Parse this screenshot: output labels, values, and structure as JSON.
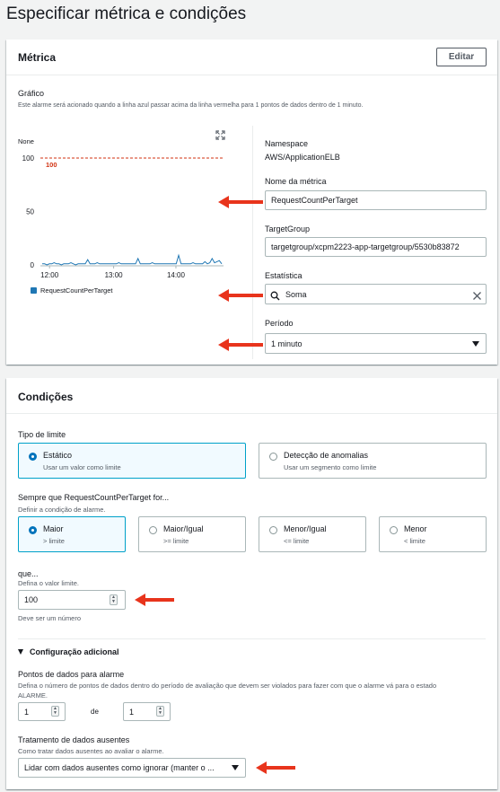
{
  "page": {
    "title": "Especificar métrica e condições"
  },
  "metric": {
    "section_title": "Métrica",
    "edit_label": "Editar",
    "graph_label": "Gráfico",
    "graph_desc": "Este alarme será acionado quando a linha azul passar acima da linha vermelha para 1 pontos de dados dentro de 1 minuto.",
    "expand_icon": "expand-icon",
    "chart_data": {
      "type": "line",
      "y_unit_label": "None",
      "ylim": [
        0,
        100
      ],
      "y_ticks": [
        "100",
        "50",
        "0"
      ],
      "x_ticks": [
        "12:00",
        "13:00",
        "14:00"
      ],
      "threshold": {
        "value": 100,
        "label": "100",
        "color": "#d13212"
      },
      "series": [
        {
          "name": "RequestCountPerTarget",
          "color": "#1f77b4",
          "values": [
            1,
            1,
            0,
            1,
            1,
            2,
            1,
            1,
            0,
            1,
            1,
            1,
            2,
            1,
            0,
            1,
            1,
            1,
            1,
            5,
            1,
            1,
            1,
            2,
            1,
            1,
            1,
            1,
            1,
            1,
            1,
            1,
            2,
            1,
            1,
            1,
            1,
            1,
            1,
            1,
            6,
            1,
            1,
            1,
            1,
            1,
            2,
            1,
            1,
            1,
            1,
            1,
            1,
            1,
            1,
            1,
            1,
            9,
            1,
            1,
            1,
            1,
            1,
            2,
            1,
            1,
            1,
            1,
            3,
            1,
            2,
            6,
            2,
            3,
            4,
            1
          ]
        }
      ]
    },
    "namespace_label": "Namespace",
    "namespace_value": "AWS/ApplicationELB",
    "metric_name_label": "Nome da métrica",
    "metric_name_value": "RequestCountPerTarget",
    "target_group_label": "TargetGroup",
    "target_group_value": "targetgroup/xcpm2223-app-targetgroup/5530b83872",
    "statistic_label": "Estatística",
    "statistic_value": "Soma",
    "period_label": "Período",
    "period_value": "1 minuto"
  },
  "conditions": {
    "section_title": "Condições",
    "threshold_type_label": "Tipo de limite",
    "static_title": "Estático",
    "static_desc": "Usar um valor como limite",
    "anomaly_title": "Detecção de anomalias",
    "anomaly_desc": "Usar um segmento como limite",
    "whenever_label": "Sempre que RequestCountPerTarget for...",
    "whenever_desc": "Definir a condição de alarme.",
    "options": [
      {
        "title": "Maior",
        "desc": "> limite"
      },
      {
        "title": "Maior/Igual",
        "desc": ">= limite"
      },
      {
        "title": "Menor/Igual",
        "desc": "<= limite"
      },
      {
        "title": "Menor",
        "desc": "< limite"
      }
    ],
    "than_label": "que...",
    "than_desc": "Defina o valor limite.",
    "threshold_value": "100",
    "threshold_hint": "Deve ser um número",
    "additional_config_label": "Configuração adicional",
    "datapoints_label": "Pontos de dados para alarme",
    "datapoints_desc_1": "Defina o número de pontos de dados dentro do período de avaliação que devem ser violados para fazer com que o alarme vá para o estado",
    "datapoints_desc_2": "ALARME.",
    "datapoints_value": "1",
    "of_label": "de",
    "evaluation_value": "1",
    "missing_label": "Tratamento de dados ausentes",
    "missing_desc": "Como tratar dados ausentes ao avaliar o alarme.",
    "missing_value": "Lidar com dados ausentes como ignorar (manter o ..."
  },
  "colors": {
    "accent": "#0073bb",
    "selected_border": "#00a1c9",
    "annotation_arrow": "#e8341c"
  }
}
